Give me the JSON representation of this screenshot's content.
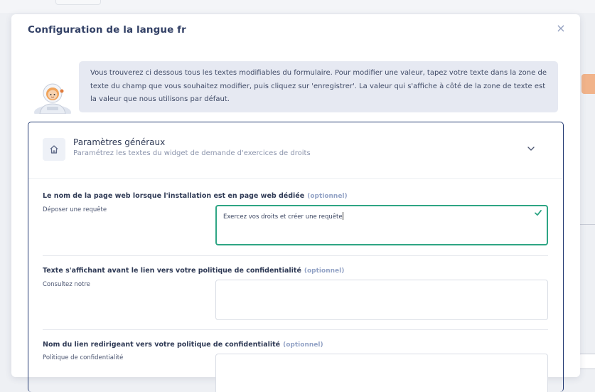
{
  "modal": {
    "title": "Configuration de la langue fr",
    "close_glyph": "×"
  },
  "info": {
    "text": "Vous trouverez ci dessous tous les textes modifiables du formulaire. Pour modifier une valeur, tapez votre texte dans la zone de texte du champ que vous souhaitez modifier, puis cliquez sur 'enregistrer'. La valeur qui s'affiche à côté de la zone de texte est la valeur que nous utilisons par défaut."
  },
  "section": {
    "title": "Paramètres généraux",
    "subtitle": "Paramétrez les textes du widget de demande d'exercices de droits",
    "icon": "home-icon"
  },
  "fields": [
    {
      "label": "Le nom de la page web lorsque l'installation est en page web dédiée",
      "optional": "(optionnel)",
      "default": "Déposer une requête",
      "value": "Exercez vos droits et créer une requête",
      "valid": true
    },
    {
      "label": "Texte s'affichant avant le lien vers votre politique de confidentialité",
      "optional": "(optionnel)",
      "default": "Consultez notre",
      "value": ""
    },
    {
      "label": "Nom du lien redirigeant vers votre politique de confidentialité",
      "optional": "(optionnel)",
      "default": "Politique de confidentialité",
      "value": ""
    }
  ],
  "colors": {
    "accent_border": "#233a72",
    "valid_green": "#2ea584",
    "info_bg": "#e6e9f2"
  }
}
